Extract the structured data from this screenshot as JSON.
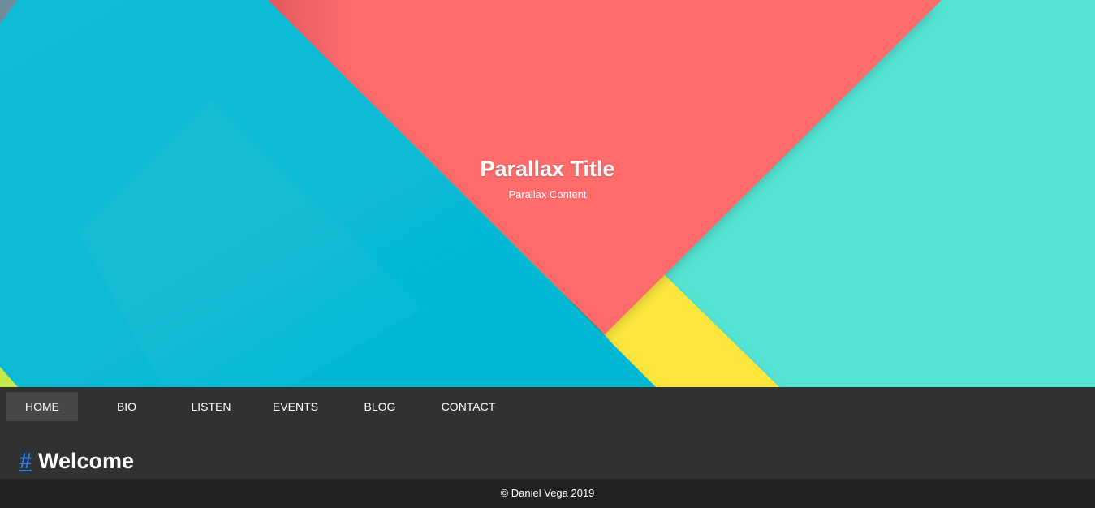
{
  "hero": {
    "title": "Parallax Title",
    "subtitle": "Parallax Content",
    "colors": {
      "teal": "#55e4d4",
      "cyan": "#0ab8d4",
      "coral": "#ff6b6b",
      "yellow": "#fde73e",
      "slate": "#607d8b",
      "lime": "#c6e94a"
    }
  },
  "nav": {
    "items": [
      {
        "label": "HOME",
        "active": true
      },
      {
        "label": "BIO",
        "active": false
      },
      {
        "label": "LISTEN",
        "active": false
      },
      {
        "label": "EVENTS",
        "active": false
      },
      {
        "label": "BLOG",
        "active": false
      },
      {
        "label": "CONTACT",
        "active": false
      }
    ]
  },
  "content": {
    "anchor_symbol": "#",
    "heading": "Welcome"
  },
  "footer": {
    "text": "© Daniel Vega 2019"
  },
  "theme": {
    "nav_background": "#313131",
    "nav_active_background": "#474747",
    "footer_background": "#222222",
    "link_color": "#2f7fe0"
  }
}
